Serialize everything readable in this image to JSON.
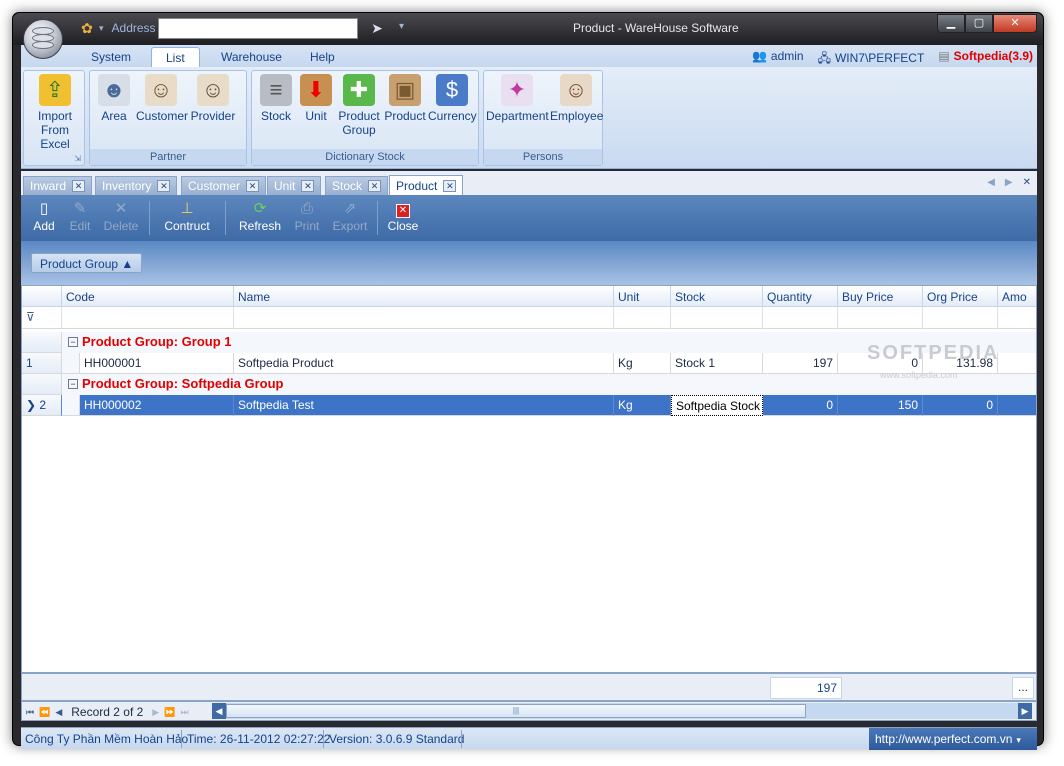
{
  "titlebar": {
    "title": "Product - WareHouse Software",
    "address_label": "Address",
    "address_value": ""
  },
  "ribbon_tabs": [
    "System",
    "List",
    "Warehouse",
    "Help"
  ],
  "active_ribbon_tab": "List",
  "user": {
    "name": "admin",
    "machine": "WIN7\\PERFECT",
    "brand": "Softpedia(3.9)"
  },
  "ribbon": {
    "import": {
      "label1": "Import",
      "label2": "From Excel"
    },
    "partner": {
      "label": "Partner",
      "buttons": [
        "Area",
        "Customer",
        "Provider"
      ]
    },
    "dictionary": {
      "label": "Dictionary Stock",
      "buttons": [
        "Stock",
        "Unit",
        "Product Group",
        "Product",
        "Currency"
      ]
    },
    "persons": {
      "label": "Persons",
      "buttons": [
        "Department",
        "Employee"
      ]
    }
  },
  "doc_tabs": [
    "Inward",
    "Inventory",
    "Customer",
    "Unit",
    "Stock",
    "Product"
  ],
  "active_doc_tab": "Product",
  "toolbar": {
    "add": "Add",
    "edit": "Edit",
    "delete": "Delete",
    "contruct": "Contruct",
    "refresh": "Refresh",
    "print": "Print",
    "export": "Export",
    "close": "Close"
  },
  "groupby": {
    "chip": "Product Group ▲"
  },
  "grid": {
    "columns": [
      "Code",
      "Name",
      "Unit",
      "Stock",
      "Quantity",
      "Buy Price",
      "Org Price",
      "Amo"
    ],
    "groups": [
      {
        "title": "Product Group: Group 1",
        "rows": [
          {
            "index": "1",
            "code": "HH000001",
            "name": "Softpedia Product",
            "unit": "Kg",
            "stock": "Stock 1",
            "quantity": "197",
            "buy_price": "0",
            "org_price": "131.98"
          }
        ]
      },
      {
        "title": "Product Group: Softpedia Group",
        "rows": [
          {
            "index": "2",
            "code": "HH000002",
            "name": "Softpedia Test",
            "unit": "Kg",
            "stock": "Softpedia Stock",
            "quantity": "0",
            "buy_price": "150",
            "org_price": "0"
          }
        ]
      }
    ],
    "watermark": "SOFTPEDIA",
    "watermark_sub": "www.softpedia.com",
    "footer_sum": "197",
    "footer_more": "..."
  },
  "navigator": {
    "record_text": "Record 2 of 2"
  },
  "status": {
    "company": "Công Ty Phần Mềm Hoàn Hảo",
    "time": "Time: 26-11-2012 02:27:22",
    "version": "Version: 3.0.6.9 Standard",
    "url": "http://www.perfect.com.vn"
  }
}
